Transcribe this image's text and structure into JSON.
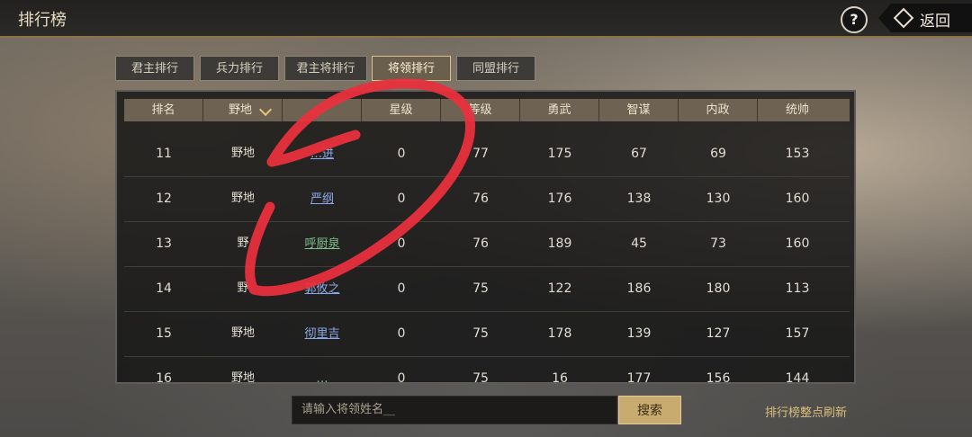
{
  "header": {
    "title": "排行榜",
    "help_label": "?",
    "back_label": "返回"
  },
  "tabs": [
    {
      "label": "君主排行",
      "active": false
    },
    {
      "label": "兵力排行",
      "active": false
    },
    {
      "label": "君主将排行",
      "active": false
    },
    {
      "label": "将领排行",
      "active": true
    },
    {
      "label": "同盟排行",
      "active": false
    }
  ],
  "table": {
    "columns": [
      "排名",
      "野地",
      "",
      "星级",
      "等级",
      "勇武",
      "智谋",
      "内政",
      "统帅"
    ],
    "rows": [
      {
        "rank": "11",
        "region": "野地",
        "name": "…进",
        "name_color": "blue",
        "star": "0",
        "level": "77",
        "valor": "175",
        "intellect": "67",
        "politics": "69",
        "command": "153"
      },
      {
        "rank": "12",
        "region": "野地",
        "name": "严纲",
        "name_color": "blue",
        "star": "0",
        "level": "76",
        "valor": "176",
        "intellect": "138",
        "politics": "130",
        "command": "160"
      },
      {
        "rank": "13",
        "region": "野",
        "name": "呼厨泉",
        "name_color": "green",
        "star": "0",
        "level": "76",
        "valor": "189",
        "intellect": "45",
        "politics": "73",
        "command": "160"
      },
      {
        "rank": "14",
        "region": "野",
        "name": "郭攸之",
        "name_color": "blue",
        "star": "0",
        "level": "75",
        "valor": "122",
        "intellect": "186",
        "politics": "180",
        "command": "113"
      },
      {
        "rank": "15",
        "region": "野地",
        "name": "彻里吉",
        "name_color": "blue",
        "star": "0",
        "level": "75",
        "valor": "178",
        "intellect": "139",
        "politics": "127",
        "command": "157"
      },
      {
        "rank": "16",
        "region": "野地",
        "name": "…",
        "name_color": "green",
        "star": "0",
        "level": "75",
        "valor": "16",
        "intellect": "177",
        "politics": "156",
        "command": "144"
      }
    ]
  },
  "search": {
    "placeholder": "请输入将领姓名__",
    "button_label": "搜索"
  },
  "footer_note": "排行榜整点刷新",
  "colors": {
    "accent_gold": "#c8ab6f",
    "annotation_red": "#e8303d"
  }
}
